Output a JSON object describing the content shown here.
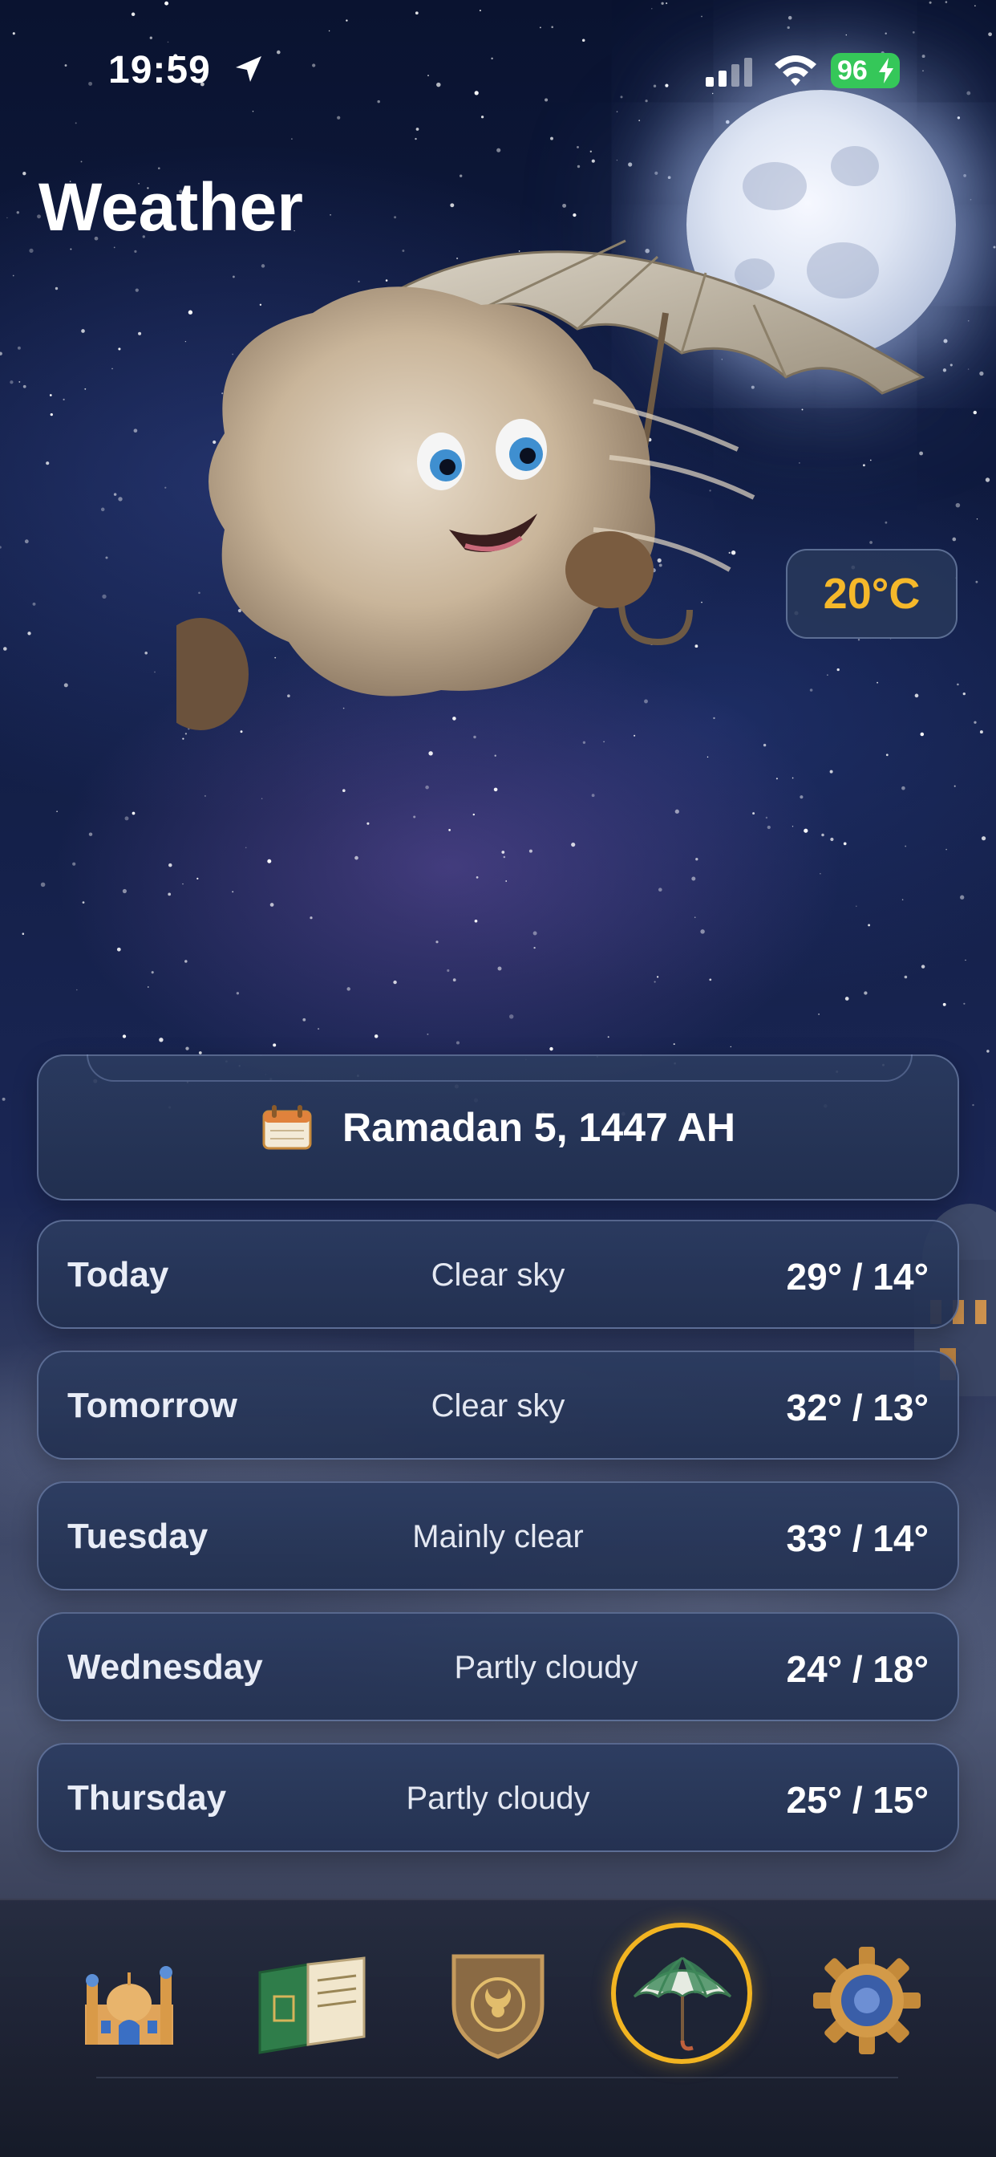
{
  "status_bar": {
    "time": "19:59",
    "battery": "96",
    "battery_color": "#35c759"
  },
  "header": {
    "title": "Weather"
  },
  "current": {
    "temperature": "20°C",
    "accent_color": "#f5b82a"
  },
  "hijri": {
    "icon": "calendar-icon",
    "date": "Ramadan 5, 1447 AH"
  },
  "forecast": [
    {
      "day": "Today",
      "condition": "Clear sky",
      "temps": "29° / 14°"
    },
    {
      "day": "Tomorrow",
      "condition": "Clear sky",
      "temps": "32° / 13°"
    },
    {
      "day": "Tuesday",
      "condition": "Mainly clear",
      "temps": "33° / 14°"
    },
    {
      "day": "Wednesday",
      "condition": "Partly cloudy",
      "temps": "24° / 18°"
    },
    {
      "day": "Thursday",
      "condition": "Partly cloudy",
      "temps": "25° / 15°"
    }
  ],
  "tab_bar": {
    "tabs": [
      {
        "icon": "mosque-icon",
        "active": false
      },
      {
        "icon": "quran-book-icon",
        "active": false
      },
      {
        "icon": "shield-emblem-icon",
        "active": false
      },
      {
        "icon": "umbrella-icon",
        "active": true
      },
      {
        "icon": "gear-icon",
        "active": false
      }
    ],
    "active_color": "#f2b421"
  }
}
